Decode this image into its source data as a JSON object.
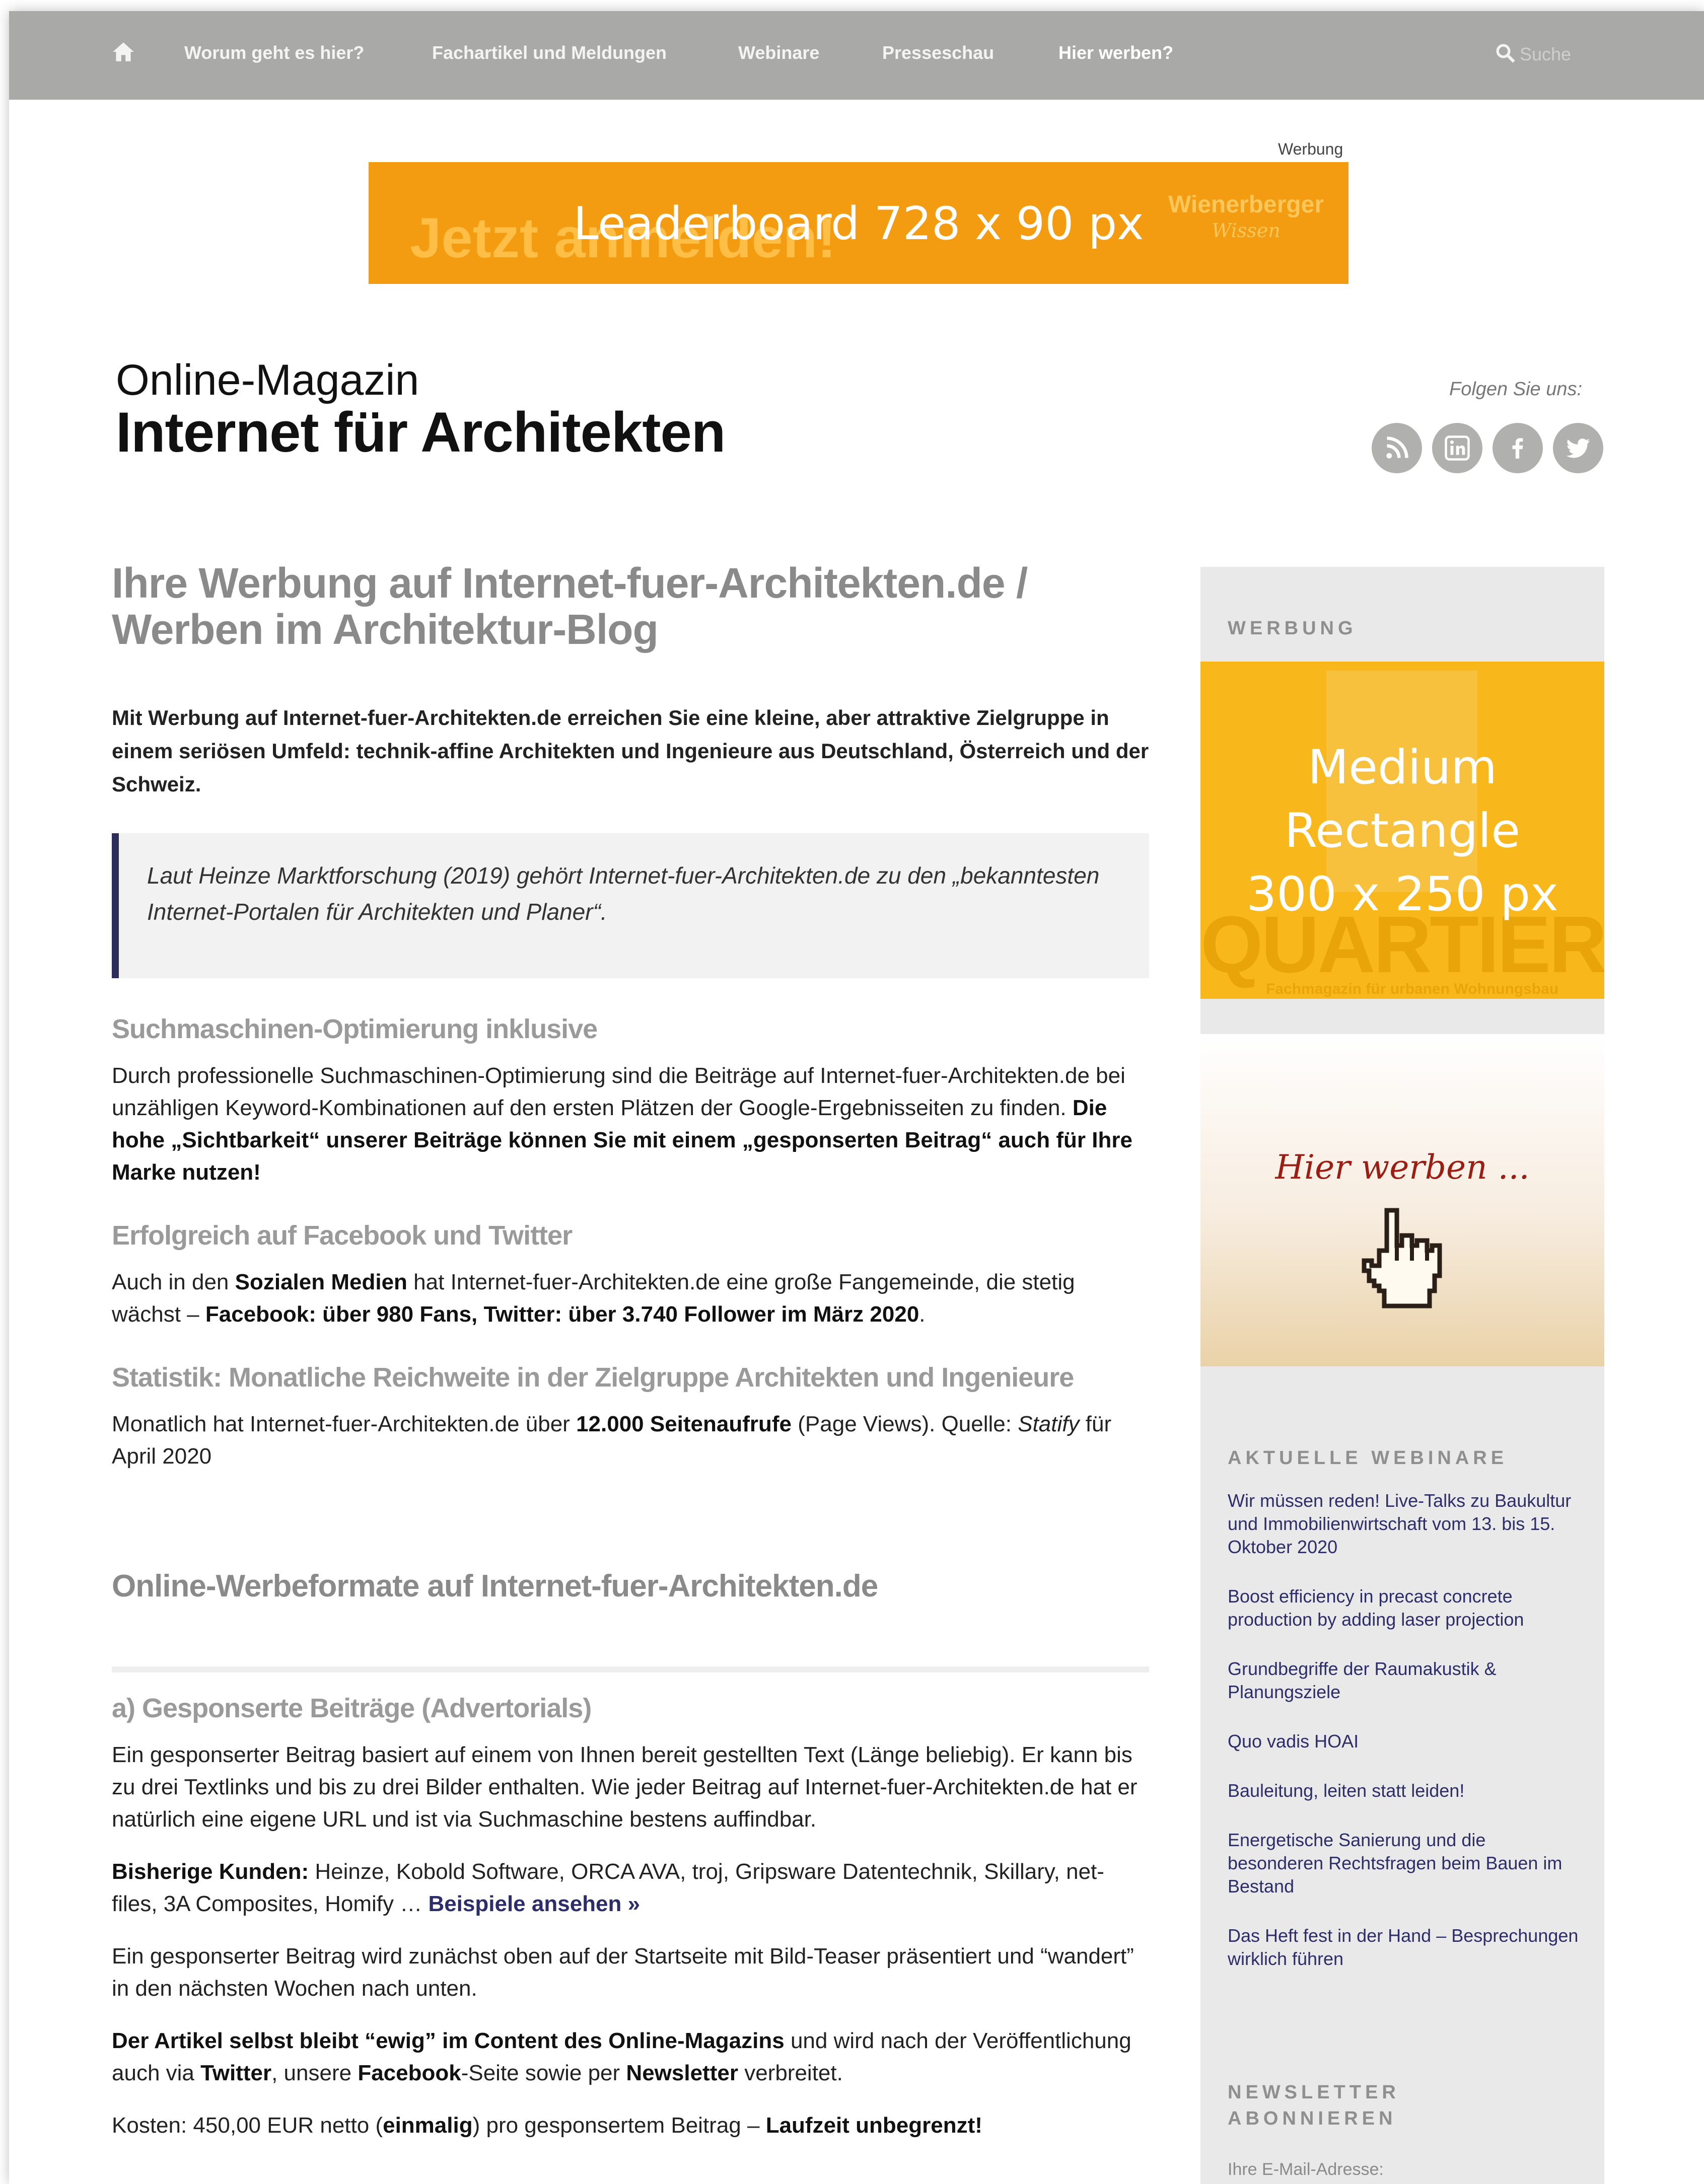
{
  "nav": {
    "items": [
      "Worum geht es hier?",
      "Fachartikel und Meldungen",
      "Webinare",
      "Presseschau",
      "Hier werben?"
    ],
    "search_placeholder": "Suche"
  },
  "ad": {
    "label": "Werbung",
    "leaderboard": "Leaderboard 728 x 90 px",
    "leaderboard_ghost": "Jetzt anmelden!",
    "leaderboard_brand": "Wienerberger",
    "leaderboard_brand_sub": "Wissen"
  },
  "masthead": {
    "line1": "Online-Magazin",
    "line2": "Internet für Architekten",
    "follow": "Folgen Sie uns:"
  },
  "social": [
    "rss-icon",
    "linkedin-icon",
    "facebook-icon",
    "twitter-icon"
  ],
  "main": {
    "title_line1": "Ihre Werbung auf Internet-fuer-Architekten.de /",
    "title_line2": "Werben im Architektur-Blog",
    "lead": "Mit Werbung auf Internet-fuer-Architekten.de erreichen Sie eine kleine, aber attraktive Ziel­gruppe in einem seriösen Umfeld: technik-affine Architekten und Ingenieure aus Deutsch­land, Österreich und der Schweiz.",
    "quote": "Laut Heinze Marktforschung (2019) gehört Internet-fuer-Architekten.de zu den „be­kanntesten Internet-Portalen für Architekten und Planer“.",
    "s1_heading": "Suchmaschinen-Optimierung inklusive",
    "s1_text": "Durch professionelle Suchmaschinen-Optimierung sind die Beiträge auf Internet-fuer-Architekten.de bei unzähligen Keyword-Kombinationen auf den ersten Plätzen der Google-Ergebnisseiten zu fin­den.",
    "s1_bold": "Die hohe „Sichtbarkeit“ unserer Beiträge können Sie mit einem „gesponserten Beitrag“ auch für Ihre Marke nutzen!",
    "s2_heading": "Erfolgreich auf Facebook und Twitter",
    "s2_a": "Auch in den",
    "s2_b": "Sozialen Medien",
    "s2_c": "hat Internet-fuer-Architekten.de eine große Fangemeinde, die stetig wächst –",
    "s2_d": "Facebook: über 980 Fans, Twitter: über 3.740 Follower im März 2020",
    "s2_e": ".",
    "s3_heading": "Statistik: Monatliche Reichweite in der Zielgruppe Architekten und Ingenieure",
    "s3_a": "Monatlich hat Internet-fuer-Architekten.de über",
    "s3_b": "12.000 Seitenaufrufe",
    "s3_c": "(Page Views). Quelle:",
    "s3_d": "Statify",
    "s3_e": "für April 2020",
    "h2": "Online-Werbeformate auf Internet-fuer-Architekten.de",
    "a_heading": "a) Gesponserte Beiträge (Advertorials)",
    "a_p1": "Ein gesponserter Beitrag basiert auf einem von Ihnen bereit gestellten Text (Länge beliebig). Er kann bis zu drei Textlinks und bis zu drei Bilder enthalten. Wie jeder Beitrag auf Internet-fuer-Architekten.de hat er natürlich eine eigene URL und ist via Suchmaschine bestens auffindbar.",
    "a_p2_label": "Bisherige Kunden:",
    "a_p2_text": "Heinze, Kobold Software, ORCA AVA, troj, Gripsware Datentechnik, Skillary, net-files, 3A Composites, Homify …",
    "a_p2_link": "Beispiele ansehen »",
    "a_p3": "Ein gesponserter Beitrag wird zunächst oben auf der Startseite mit Bild-Teaser präsentiert und “wandert” in den nächsten Wochen nach unten.",
    "a_p4_a": "Der Artikel selbst bleibt “ewig” im Content des Online-Magazins",
    "a_p4_b": "und wird nach der Veröffentli­chung auch via",
    "a_p4_c": "Twitter",
    "a_p4_d": ", unsere",
    "a_p4_e": "Facebook",
    "a_p4_f": "-Seite sowie per",
    "a_p4_g": "Newsletter",
    "a_p4_h": "verbreitet.",
    "a_p5_a": "Kosten: 450,00 EUR netto (",
    "a_p5_b": "einmalig",
    "a_p5_c": ") pro gesponsertem Beitrag –",
    "a_p5_d": "Laufzeit unbegrenzt!"
  },
  "sidebar": {
    "werbung_heading": "WERBUNG",
    "medium_rectangle": [
      "Medium",
      "Rectangle",
      "300 x 250 px"
    ],
    "medium_bg_title": "QUARTIER",
    "medium_bg_sub": "Fachmagazin für urbanen Wohnungsbau",
    "hier_werben": "Hier werben ...",
    "webinare_heading": "AKTUELLE WEBINARE",
    "webinare": [
      "Wir müssen reden! Live-Talks zu Baukultur und Immobilienwirtschaft vom 13. bis 15. Oktober 2020",
      "Boost efficiency in precast concrete production by adding laser projection",
      "Grundbegriffe der Raumakustik & Planungsziele",
      "Quo vadis HOAI",
      "Bauleitung, leiten statt leiden!",
      "Energetische Sanierung und die besonderen Rechtsfragen beim Bauen im Bestand",
      "Das Heft fest in der Hand – Besprechungen wirklich führen"
    ],
    "newsletter_heading_1": "NEWSLETTER",
    "newsletter_heading_2": "ABONNIEREN",
    "newsletter_label": "Ihre E-Mail-Adresse:"
  },
  "colors": {
    "nav_bg": "#a9a9a7",
    "leaderboard": "#f39c12",
    "medium_rectangle": "#f8b81b",
    "link": "#2d2d6a",
    "quote_bar": "#2d2d5a"
  }
}
